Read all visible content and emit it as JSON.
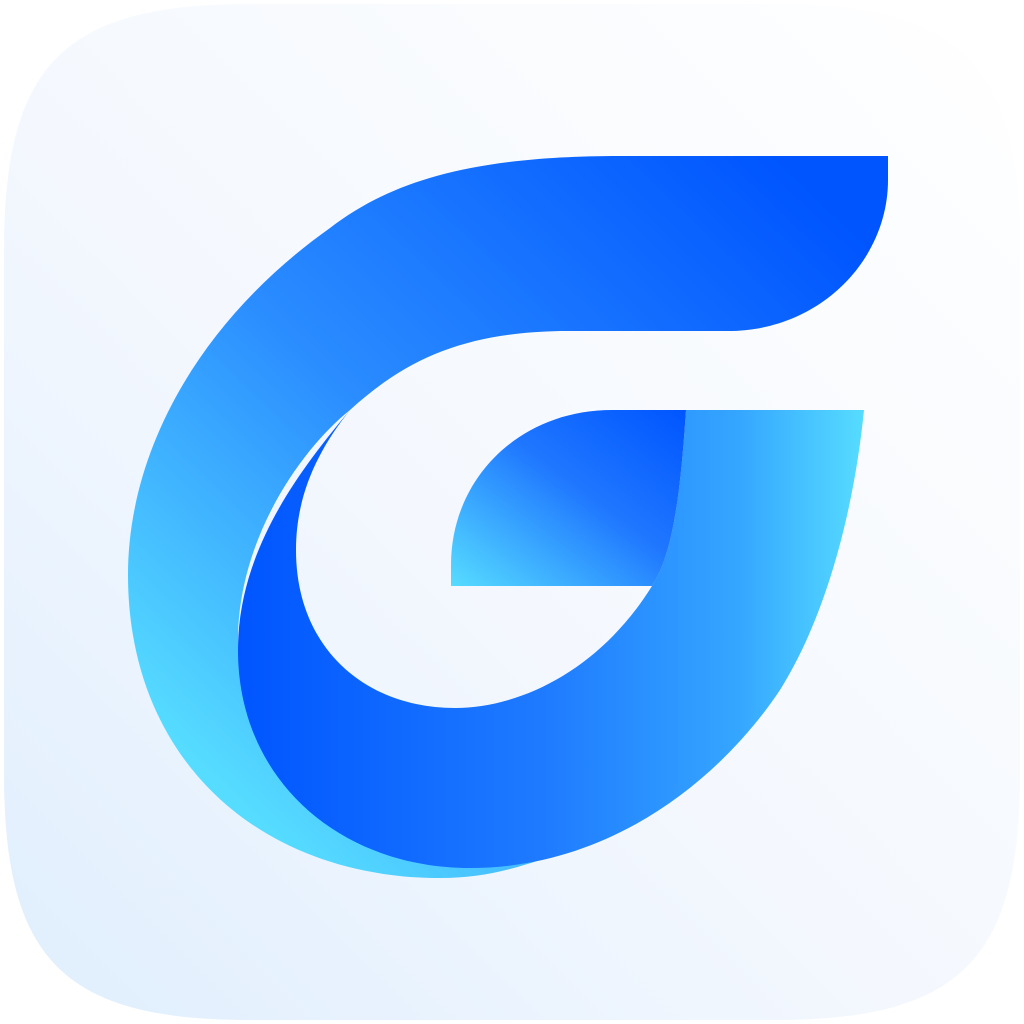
{
  "icon": {
    "name": "app-icon-g-logo",
    "colors": {
      "background_light": "#ffffff",
      "background_tint": "#dfeefd",
      "blue_deep": "#0055ff",
      "blue_mid": "#2a8cff",
      "cyan_light": "#56dcff"
    }
  }
}
